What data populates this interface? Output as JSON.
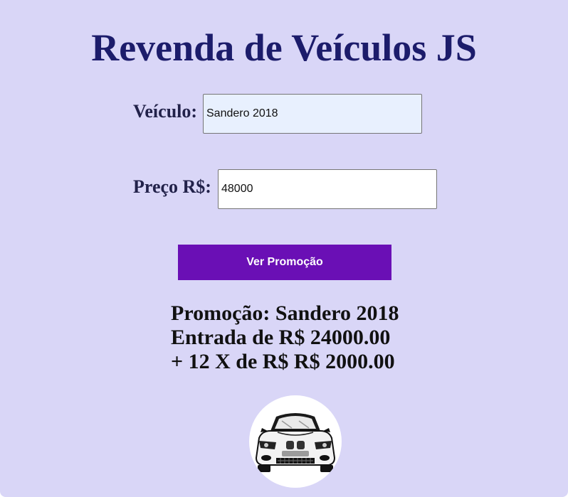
{
  "header": {
    "title": "Revenda de Veículos JS"
  },
  "form": {
    "vehicle_label": "Veículo:",
    "vehicle_value": "Sandero 2018",
    "price_label": "Preço R$:",
    "price_value": "48000",
    "submit_label": "Ver Promoção"
  },
  "result": {
    "line1": "Promoção: Sandero 2018",
    "line2": "Entrada de R$ 24000.00",
    "line3": "+ 12 X de R$ R$ 2000.00"
  },
  "image": {
    "icon": "car-icon"
  },
  "colors": {
    "background": "#d9d6f7",
    "title": "#1c1c6b",
    "button": "#6a0fb5",
    "button_text": "#ffffff"
  }
}
